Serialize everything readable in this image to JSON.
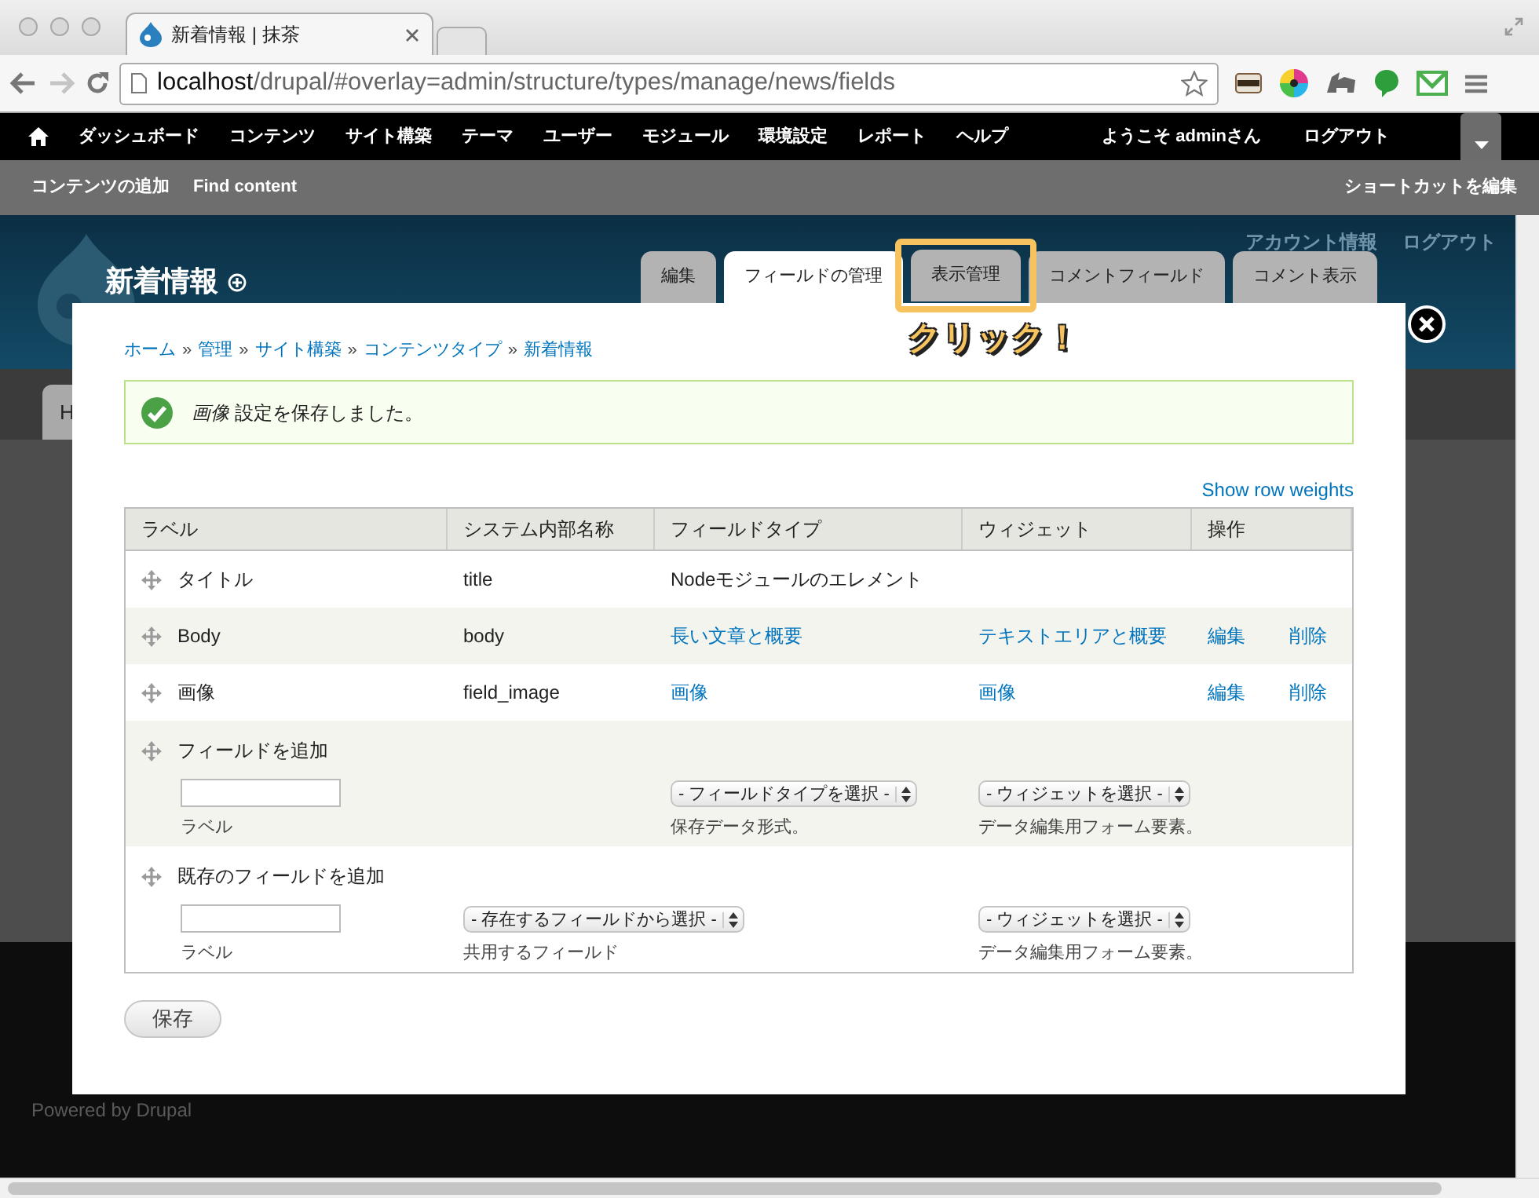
{
  "browser": {
    "tab_title": "新着情報 | 抹茶",
    "address_host": "localhost",
    "address_path": "/drupal/#overlay=admin/structure/types/manage/news/fields"
  },
  "toolbar": {
    "menu": [
      "ダッシュボード",
      "コンテンツ",
      "サイト構築",
      "テーマ",
      "ユーザー",
      "モジュール",
      "環境設定",
      "レポート",
      "ヘルプ"
    ],
    "greeting": "ようこそ adminさん",
    "logout": "ログアウト"
  },
  "shortcuts": {
    "items": [
      "コンテンツの追加",
      "Find content"
    ],
    "edit": "ショートカットを編集"
  },
  "header": {
    "secondary_links": [
      "アカウント情報",
      "ログアウト"
    ],
    "title": "新着情報",
    "tabs": [
      {
        "label": "編集",
        "selected": false,
        "highlighted": false
      },
      {
        "label": "フィールドの管理",
        "selected": true,
        "highlighted": false
      },
      {
        "label": "表示管理",
        "selected": false,
        "highlighted": true
      },
      {
        "label": "コメントフィールド",
        "selected": false,
        "highlighted": false
      },
      {
        "label": "コメント表示",
        "selected": false,
        "highlighted": false
      }
    ],
    "annotation": "クリック！"
  },
  "page": {
    "tab_fragment": "H",
    "footer": "Powered by Drupal"
  },
  "overlay": {
    "breadcrumb": {
      "items": [
        "ホーム",
        "管理",
        "サイト構築",
        "コンテンツタイプ",
        "新着情報"
      ],
      "separator": "»"
    },
    "message": "*画像* 設定を保存しました。",
    "show_weights": "Show row weights",
    "columns": [
      "ラベル",
      "システム内部名称",
      "フィールドタイプ",
      "ウィジェット",
      "操作"
    ],
    "rows": [
      {
        "kind": "base",
        "label": "タイトル",
        "machine_name": "title",
        "field_type": "Nodeモジュールのエレメント"
      },
      {
        "kind": "field",
        "label": "Body",
        "machine_name": "body",
        "field_type": "長い文章と概要",
        "widget": "テキストエリアと概要",
        "operations": [
          "編集",
          "削除"
        ]
      },
      {
        "kind": "field",
        "label": "画像",
        "machine_name": "field_image",
        "field_type": "画像",
        "widget": "画像",
        "operations": [
          "編集",
          "削除"
        ]
      }
    ],
    "add_rows": [
      {
        "kind": "new",
        "title": "フィールドを追加",
        "label_caption": "ラベル",
        "selects": [
          {
            "text": "- フィールドタイプを選択 -",
            "caption": "保存データ形式。"
          },
          {
            "text": "- ウィジェットを選択 -",
            "caption": "データ編集用フォーム要素。"
          }
        ]
      },
      {
        "kind": "existing",
        "title": "既存のフィールドを追加",
        "label_caption": "ラベル",
        "selects": [
          {
            "text": "- 存在するフィールドから選択 -",
            "caption": "共用するフィールド"
          },
          {
            "text": "- ウィジェットを選択 -",
            "caption": "データ編集用フォーム要素。"
          }
        ]
      }
    ],
    "save": "保存"
  }
}
